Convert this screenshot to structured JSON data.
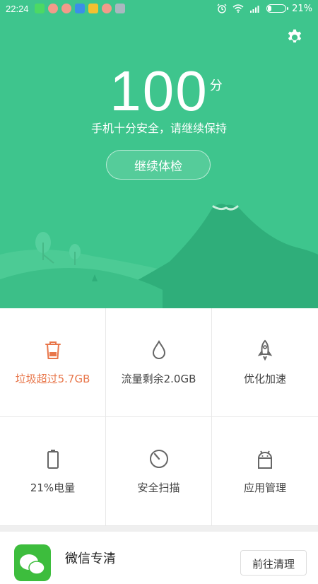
{
  "status_bar": {
    "time": "22:24",
    "battery": "21%",
    "battery_level": 0.21,
    "notification_icons": [
      "wechat-icon",
      "avatar-icon",
      "avatar-icon",
      "cloud-icon",
      "app-icon",
      "avatar-icon",
      "mail-icon"
    ]
  },
  "hero": {
    "score": "100",
    "score_unit": "分",
    "subtitle": "手机十分安全，请继续保持",
    "continue_label": "继续体检"
  },
  "tools": [
    {
      "label": "垃圾超过5.7GB",
      "icon": "trash-icon",
      "highlight": true
    },
    {
      "label": "流量剩余2.0GB",
      "icon": "droplet-icon",
      "highlight": false
    },
    {
      "label": "优化加速",
      "icon": "rocket-icon",
      "highlight": false
    },
    {
      "label": "21%电量",
      "icon": "battery-icon",
      "highlight": false
    },
    {
      "label": "安全扫描",
      "icon": "scan-icon",
      "highlight": false
    },
    {
      "label": "应用管理",
      "icon": "android-icon",
      "highlight": false
    }
  ],
  "card": {
    "title": "微信专清",
    "button_label": "前往清理"
  },
  "colors": {
    "accent": "#3ec58d",
    "warning": "#e8764a"
  }
}
